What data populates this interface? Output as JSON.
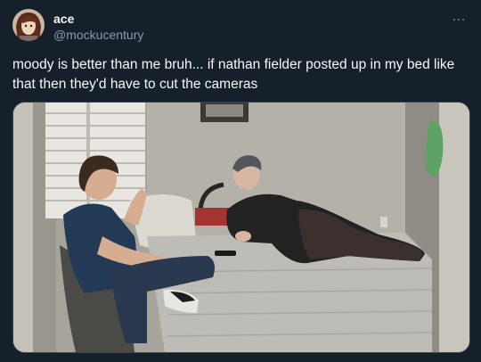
{
  "author": {
    "display_name": "ace",
    "handle": "@mockucentury"
  },
  "more_icon": "…",
  "tweet": {
    "text": "moody is better than me bruh... if nathan fielder posted up in my bed like that then they'd have to cut the cameras"
  },
  "media": {
    "icon": "photo"
  },
  "colors": {
    "background": "#15202b",
    "text": "#f7f9f9",
    "muted": "#8b98a5",
    "border": "#38444d"
  }
}
